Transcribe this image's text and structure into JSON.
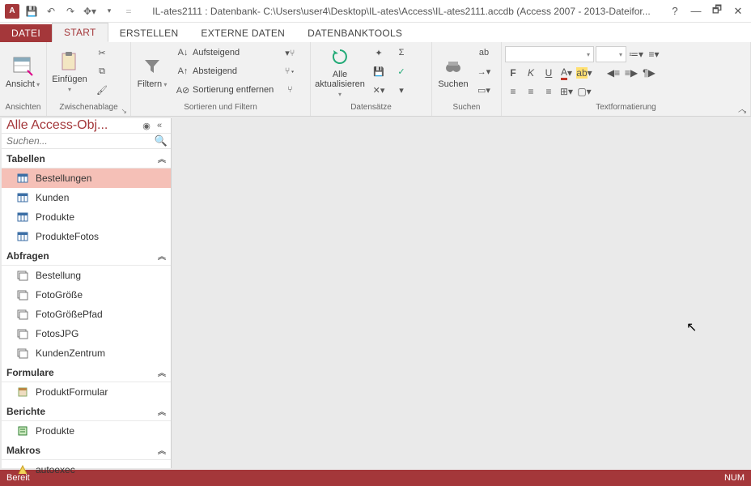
{
  "titlebar": {
    "title": "IL-ates2111 : Datenbank- C:\\Users\\user4\\Desktop\\IL-ates\\Access\\IL-ates2111.accdb (Access 2007 - 2013-Dateifor..."
  },
  "tabs": {
    "file": "DATEI",
    "items": [
      "START",
      "ERSTELLEN",
      "EXTERNE DATEN",
      "DATENBANKTOOLS"
    ],
    "active_index": 0
  },
  "ribbon": {
    "ansichten": {
      "label": "Ansichten",
      "ansicht": "Ansicht"
    },
    "zwischenablage": {
      "label": "Zwischenablage",
      "einfuegen": "Einfügen"
    },
    "sortfilter": {
      "label": "Sortieren und Filtern",
      "filtern": "Filtern",
      "aufsteigend": "Aufsteigend",
      "absteigend": "Absteigend",
      "sort_entfernen": "Sortierung entfernen"
    },
    "datensaetze": {
      "label": "Datensätze",
      "alle_akt": "Alle\naktualisieren"
    },
    "suchen": {
      "label": "Suchen",
      "suchen": "Suchen"
    },
    "textfmt": {
      "label": "Textformatierung"
    }
  },
  "nav": {
    "title": "Alle Access-Obj...",
    "search_placeholder": "Suchen...",
    "categories": [
      {
        "key": "tabellen",
        "label": "Tabellen",
        "items": [
          "Bestellungen",
          "Kunden",
          "Produkte",
          "ProdukteFotos"
        ],
        "icon": "table",
        "selected_index": 0
      },
      {
        "key": "abfragen",
        "label": "Abfragen",
        "items": [
          "Bestellung",
          "FotoGröße",
          "FotoGrößePfad",
          "FotosJPG",
          "KundenZentrum"
        ],
        "icon": "query"
      },
      {
        "key": "formulare",
        "label": "Formulare",
        "items": [
          "ProduktFormular"
        ],
        "icon": "form"
      },
      {
        "key": "berichte",
        "label": "Berichte",
        "items": [
          "Produkte"
        ],
        "icon": "report"
      },
      {
        "key": "makros",
        "label": "Makros",
        "items": [
          "autoexec"
        ],
        "icon": "macro"
      }
    ]
  },
  "statusbar": {
    "left": "Bereit",
    "right": "NUM"
  }
}
